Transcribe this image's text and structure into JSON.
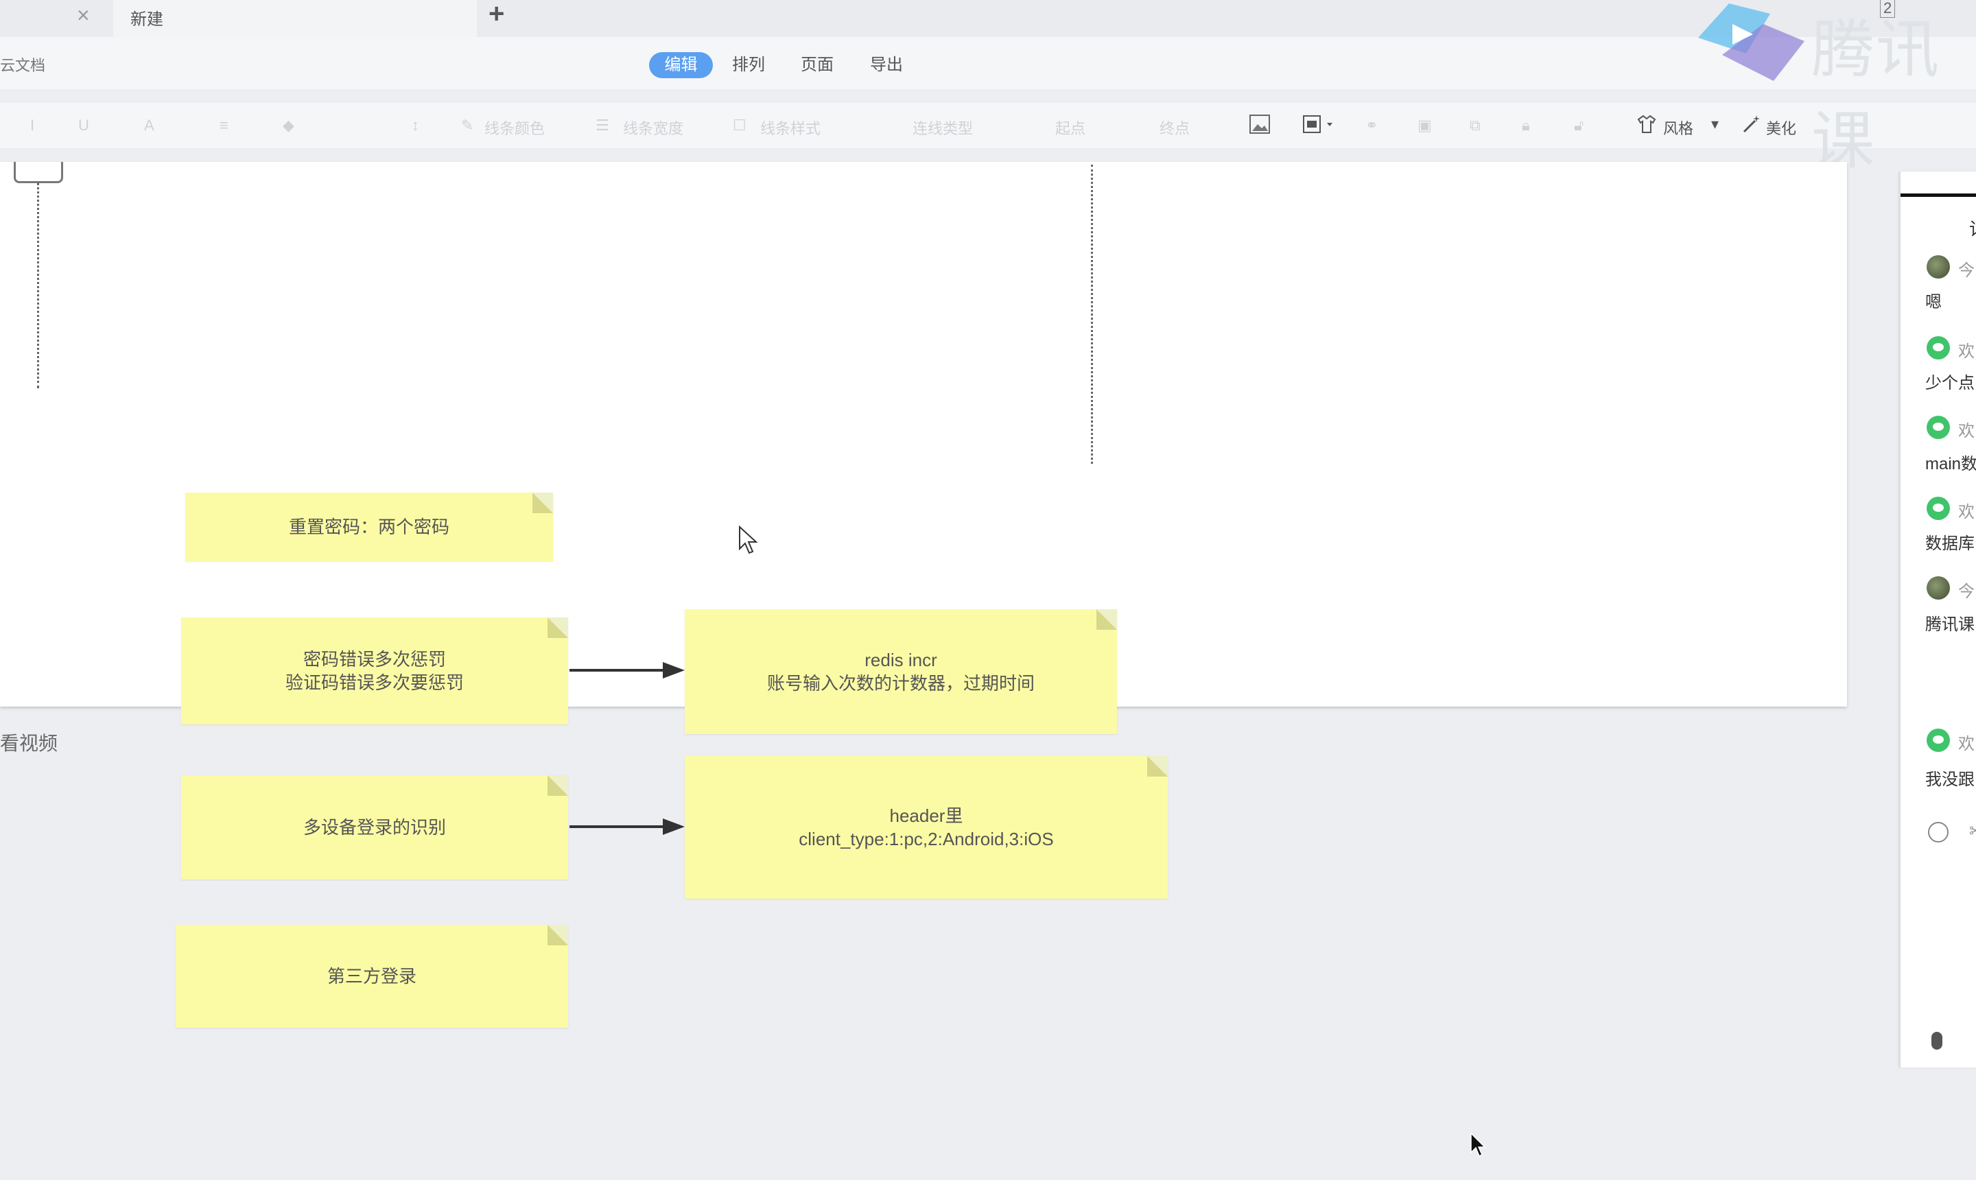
{
  "tabs": {
    "active_title": "新建",
    "close_glyph": "×",
    "new_tab_glyph": "+"
  },
  "menubar": {
    "doc_label": "云文档",
    "items": [
      "编辑",
      "排列",
      "页面",
      "导出"
    ]
  },
  "toolbar": {
    "items": [
      "线条颜色",
      "线条宽度",
      "线条样式",
      "连线类型",
      "起点",
      "终点"
    ],
    "style_label": "风格",
    "beautify_label": "美化",
    "font_glyph": "A"
  },
  "watermark": {
    "brand": "腾讯课",
    "count": "2"
  },
  "canvas": {
    "side_label": "看视频"
  },
  "notes": [
    {
      "text": "重置密码：两个密码"
    },
    {
      "text": "密码错误多次惩罚\n验证码错误多次要惩罚"
    },
    {
      "text": "多设备登录的识别"
    },
    {
      "text": "第三方登录"
    },
    {
      "text": "redis incr\n账号输入次数的计数器，过期时间"
    },
    {
      "text": "header里\nclient_type:1:pc,2:Android,3:iOS"
    }
  ],
  "chat": {
    "header_char": "讨",
    "messages": [
      {
        "name": "今",
        "text": "嗯",
        "avatar": "photo"
      },
      {
        "name": "欢",
        "text": "少个点",
        "avatar": "wechat"
      },
      {
        "name": "欢",
        "text": "main数",
        "avatar": "wechat"
      },
      {
        "name": "欢",
        "text": "数据库",
        "avatar": "wechat"
      },
      {
        "name": "今",
        "text": "腾讯课",
        "avatar": "photo"
      },
      {
        "name": "欢",
        "text": "我没跟",
        "avatar": "wechat"
      }
    ],
    "scissors_glyph": "✂"
  },
  "colors": {
    "note_fill": "#fbfba5",
    "accent": "#5b9ff0",
    "wechat_green": "#40c46b"
  }
}
